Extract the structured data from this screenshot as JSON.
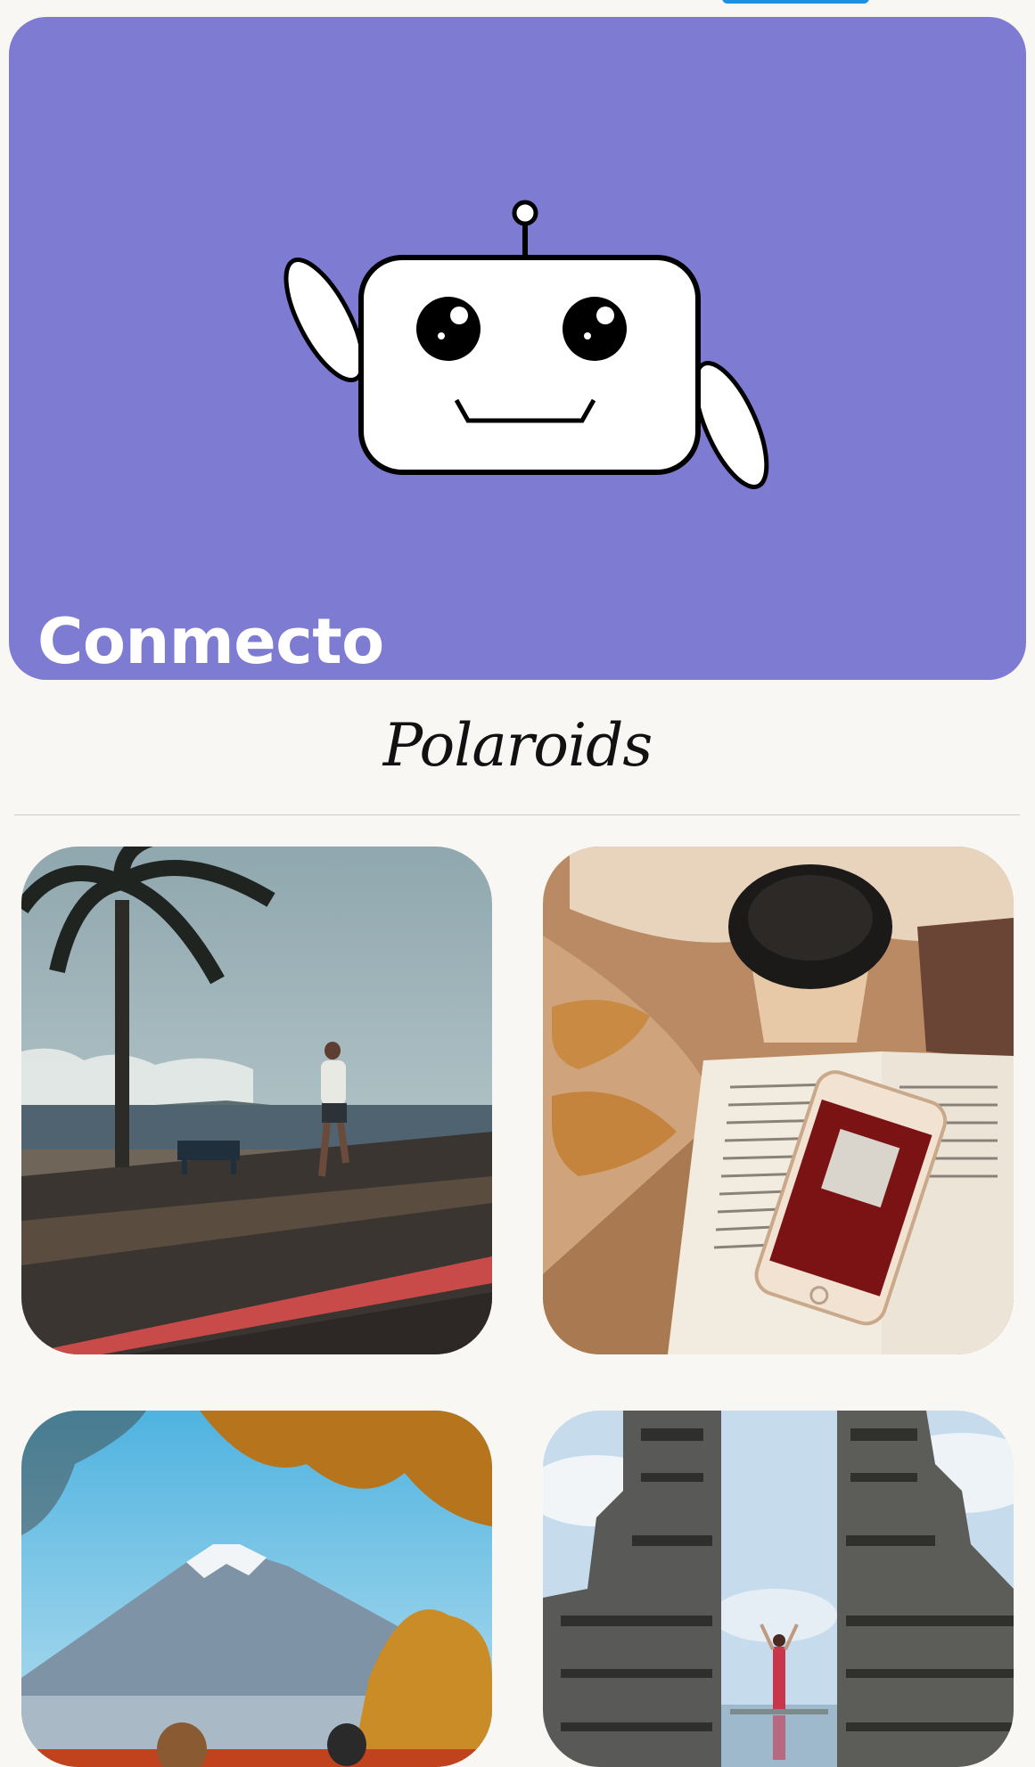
{
  "hero": {
    "title": "Conmecto",
    "background_color": "#7e7bd3",
    "illustration": "robot-mascot-icon"
  },
  "section": {
    "title": "Polaroids"
  },
  "polaroids": [
    {
      "subject": "runner-on-seaside-promenade-photo"
    },
    {
      "subject": "coffee-croissants-book-phone-photo"
    },
    {
      "subject": "mount-fuji-autumn-photo"
    },
    {
      "subject": "bali-temple-gate-photo"
    }
  ]
}
